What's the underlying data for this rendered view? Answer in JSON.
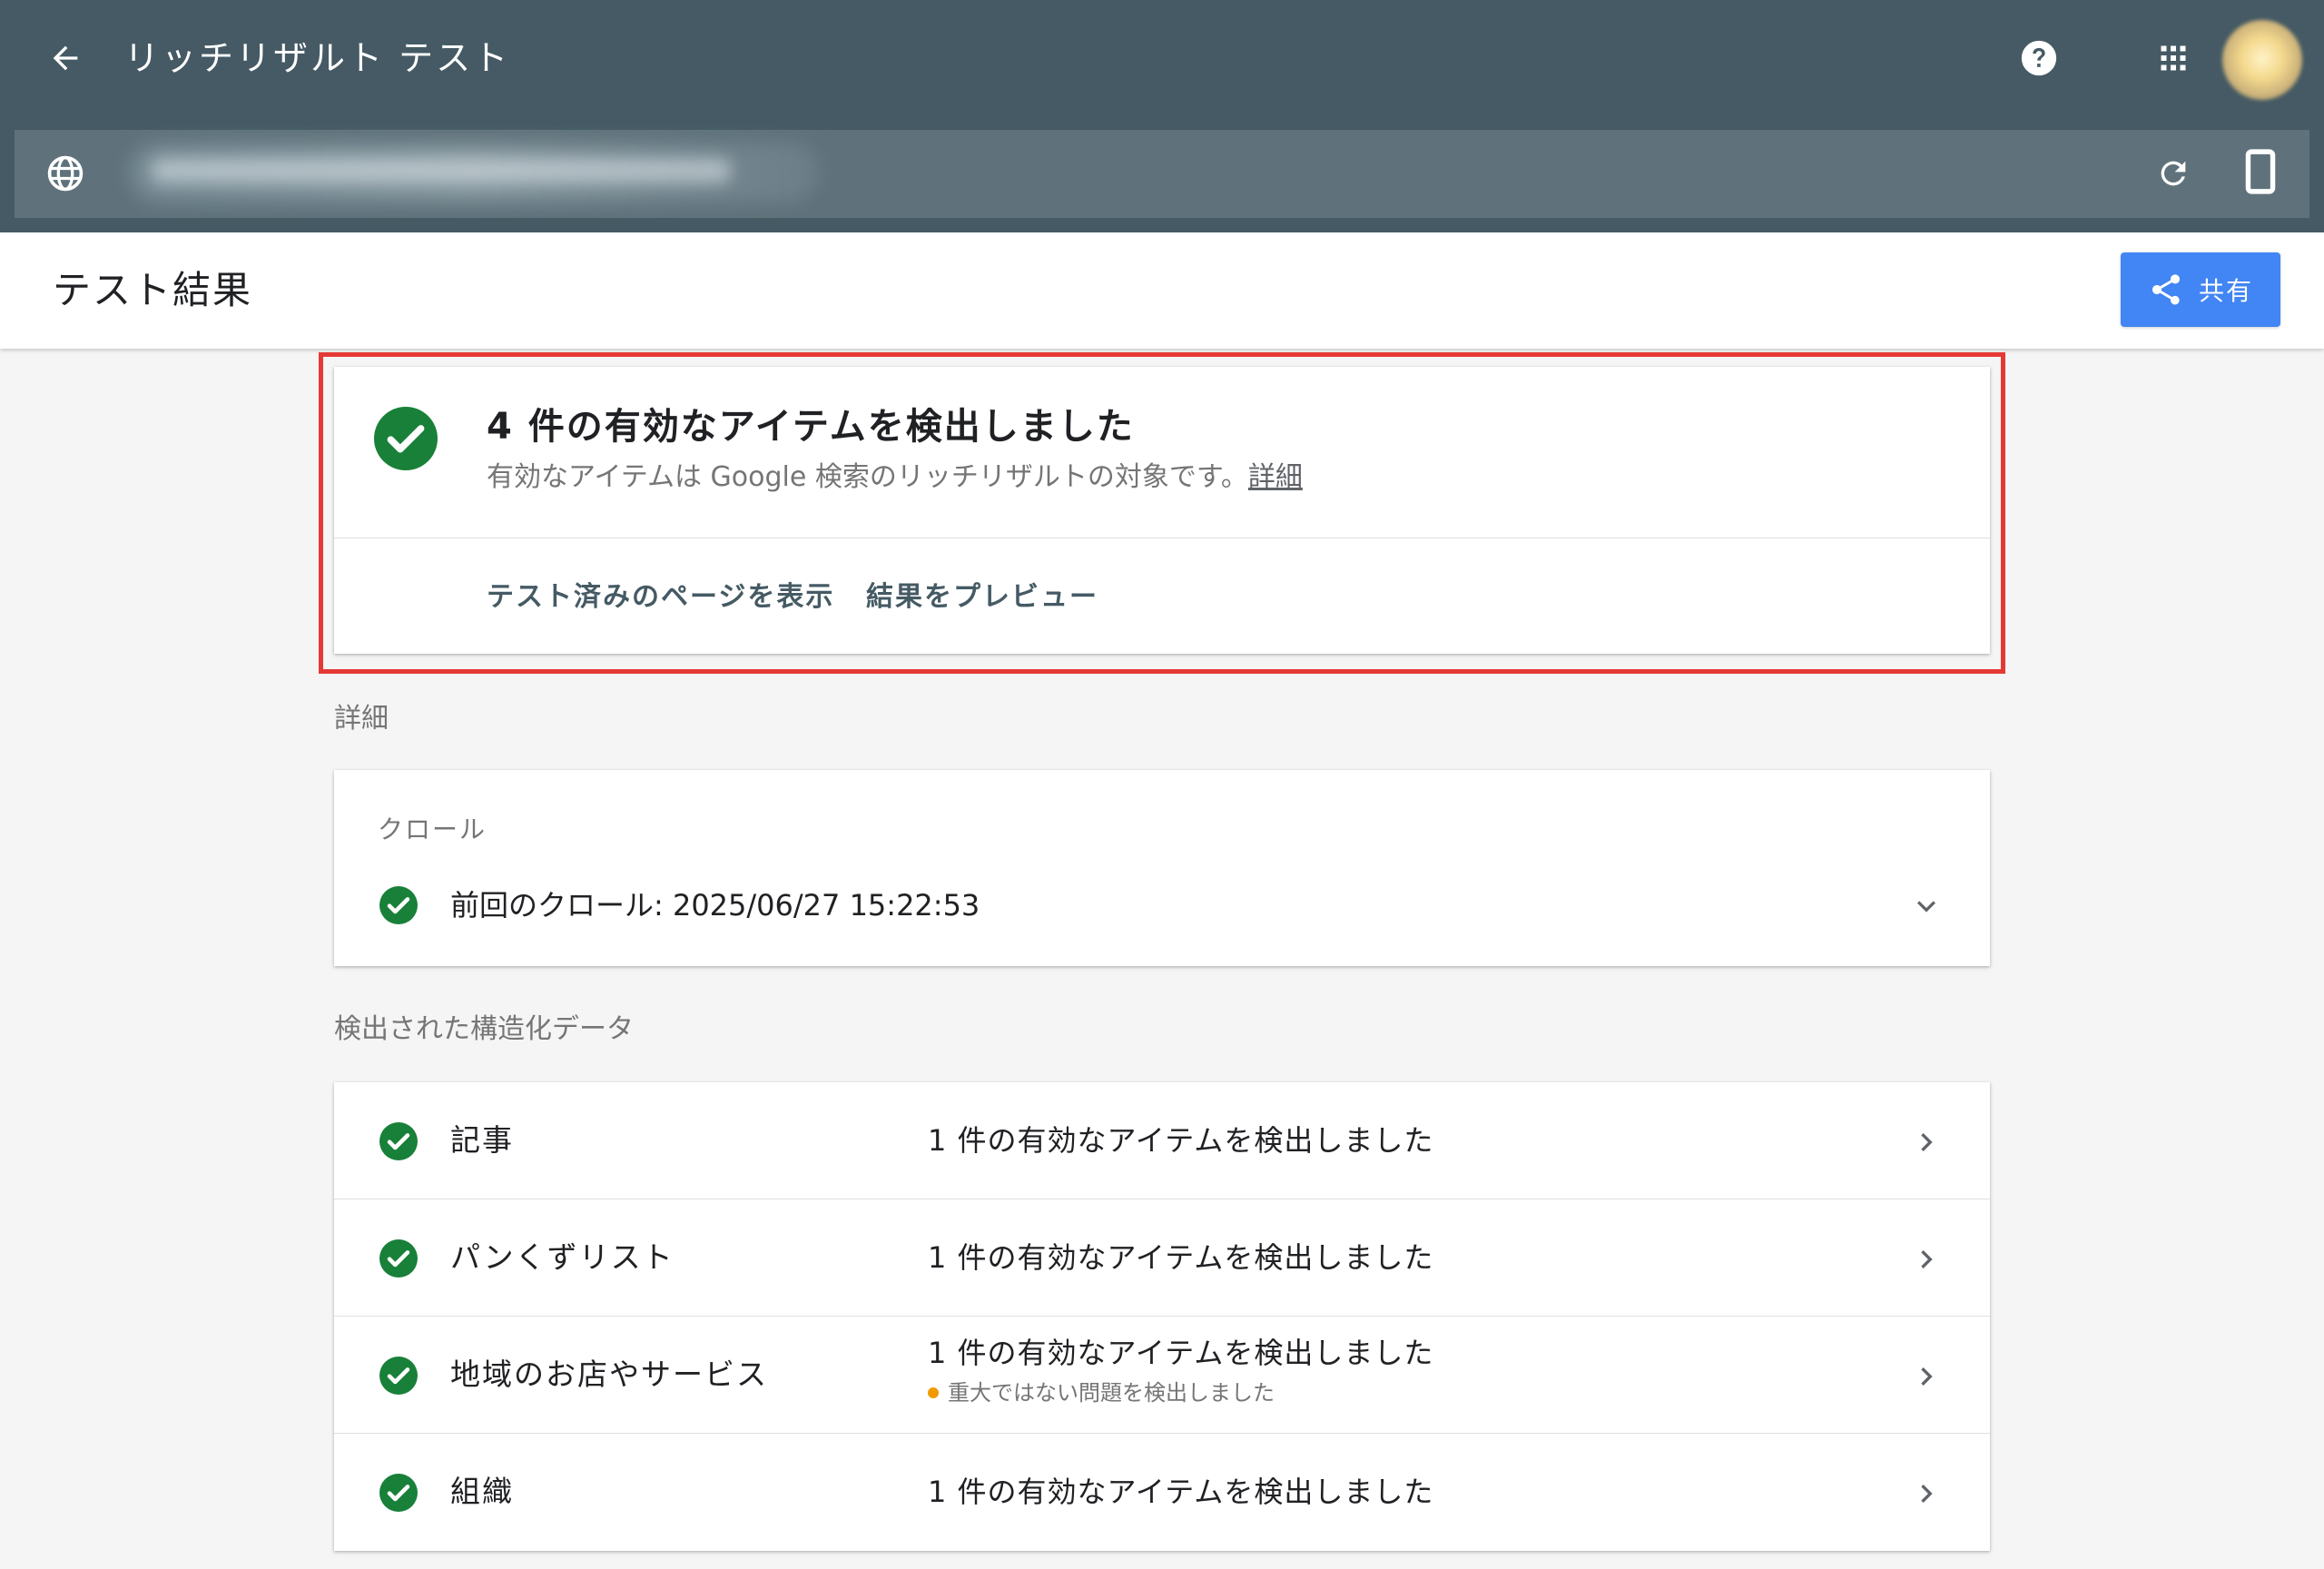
{
  "app": {
    "title": "リッチリザルト テスト"
  },
  "header": {
    "title": "テスト結果",
    "share_label": "共有"
  },
  "summary": {
    "title": "4 件の有効なアイテムを検出しました",
    "subtitle": "有効なアイテムは Google 検索のリッチリザルトの対象です。",
    "link_label": "詳細",
    "actions": [
      "テスト済みのページを表示",
      "結果をプレビュー"
    ]
  },
  "details": {
    "section_label": "詳細",
    "crawl": {
      "heading": "クロール",
      "text": "前回のクロール: 2025/06/27 15:22:53"
    }
  },
  "structured_data": {
    "section_label": "検出された構造化データ",
    "items": [
      {
        "name": "記事",
        "status": "1 件の有効なアイテムを検出しました"
      },
      {
        "name": "パンくずリスト",
        "status": "1 件の有効なアイテムを検出しました"
      },
      {
        "name": "地域のお店やサービス",
        "status": "1 件の有効なアイテムを検出しました",
        "warning": "重大ではない問題を検出しました"
      },
      {
        "name": "組織",
        "status": "1 件の有効なアイテムを検出しました"
      }
    ]
  },
  "colors": {
    "appbar": "#455a64",
    "urlbar": "#5f727b",
    "success_green": "#188038",
    "share_blue": "#4285f4",
    "highlight_red": "#e53935",
    "warning_orange": "#f29900"
  },
  "icons": {
    "back": "arrow-back-icon",
    "help": "help-icon",
    "apps": "apps-grid-icon",
    "globe": "globe-icon",
    "reload": "reload-icon",
    "device": "smartphone-icon",
    "share": "share-icon",
    "check": "check-circle-icon",
    "expand": "chevron-down-icon",
    "row": "chevron-right-icon"
  }
}
